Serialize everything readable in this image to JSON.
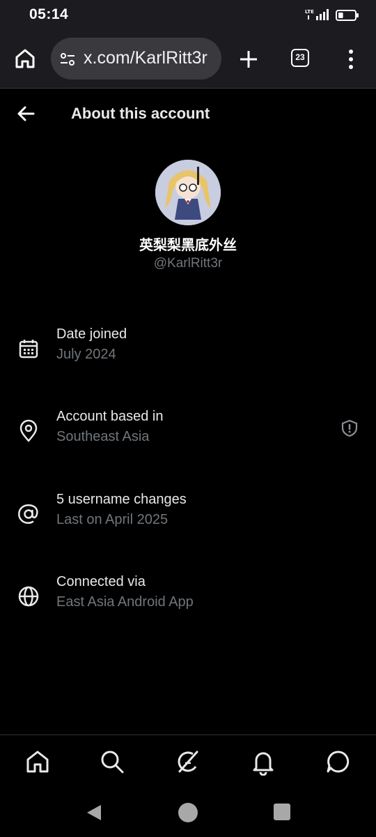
{
  "status_bar": {
    "time": "05:14",
    "network_label": "LTE",
    "battery_level": 0.3
  },
  "browser": {
    "url": "x.com/KarlRitt3r",
    "tab_count": "23",
    "icons": [
      "home-icon",
      "tune-icon",
      "plus-icon",
      "tabs-icon",
      "more-vert-icon"
    ]
  },
  "header": {
    "title": "About this account",
    "back_icon": "arrow-left-icon"
  },
  "profile": {
    "display_name": "英梨梨黑底外丝",
    "handle": "@KarlRitt3r"
  },
  "info": {
    "joined": {
      "title": "Date joined",
      "value": "July 2024",
      "icon": "calendar-icon"
    },
    "based_in": {
      "title": "Account based in",
      "value": "Southeast Asia",
      "icon": "location-pin-icon",
      "badge_icon": "shield-alert-icon"
    },
    "username": {
      "title": "5 username changes",
      "value": "Last on April 2025",
      "icon": "at-sign-icon"
    },
    "connected": {
      "title": "Connected via",
      "value": "East Asia Android App",
      "icon": "globe-icon"
    }
  },
  "bottom_nav": [
    "home-icon",
    "search-icon",
    "grok-icon",
    "notifications-icon",
    "messages-icon"
  ],
  "colors": {
    "background": "#000000",
    "primary_text": "#e7e9ea",
    "secondary_text": "#71767b",
    "browser_chrome": "#1c1b1f"
  }
}
